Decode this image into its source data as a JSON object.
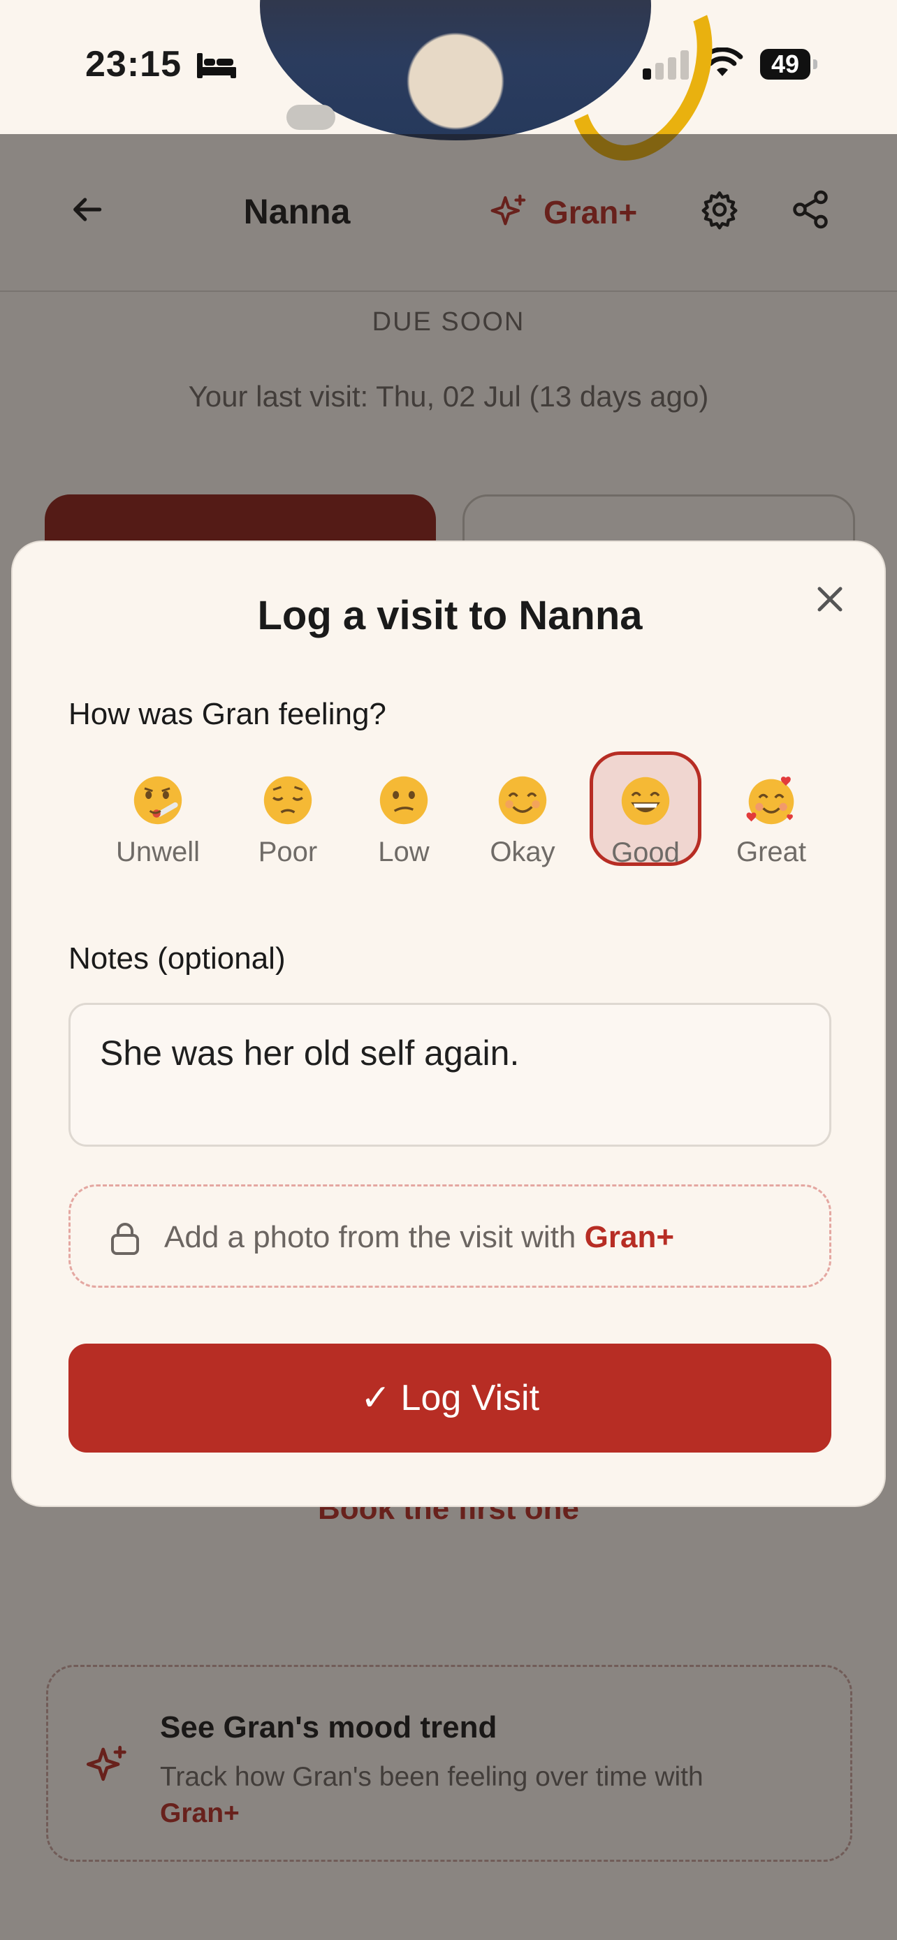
{
  "status_bar": {
    "time": "23:15",
    "battery": "49"
  },
  "header": {
    "title": "Nanna",
    "gran_plus_label": "Gran+"
  },
  "background": {
    "due_soon": "DUE SOON",
    "last_visit": "Your last visit: Thu, 02 Jul (13 days ago)",
    "book_first": "Book the first one",
    "promo": {
      "title": "See Gran's mood trend",
      "text": "Track how Gran's been feeling over time with",
      "link": "Gran+"
    }
  },
  "modal": {
    "title": "Log a visit to Nanna",
    "feeling_label": "How was Gran feeling?",
    "moods": [
      {
        "label": "Unwell",
        "icon": "face-with-thermometer-icon",
        "selected": false
      },
      {
        "label": "Poor",
        "icon": "pensive-face-icon",
        "selected": false
      },
      {
        "label": "Low",
        "icon": "confused-face-icon",
        "selected": false
      },
      {
        "label": "Okay",
        "icon": "smiling-face-icon",
        "selected": false
      },
      {
        "label": "Good",
        "icon": "grinning-face-icon",
        "selected": true
      },
      {
        "label": "Great",
        "icon": "smiling-face-with-hearts-icon",
        "selected": false
      }
    ],
    "notes_label": "Notes (optional)",
    "notes_value": "She was her old self again.",
    "photo_text": "Add a photo from the visit with",
    "photo_link": "Gran+",
    "log_button_check": "✓",
    "log_button": "Log Visit"
  },
  "colors": {
    "accent": "#b72d24",
    "background": "#fbf5ee",
    "ring": "#e9b10f"
  }
}
